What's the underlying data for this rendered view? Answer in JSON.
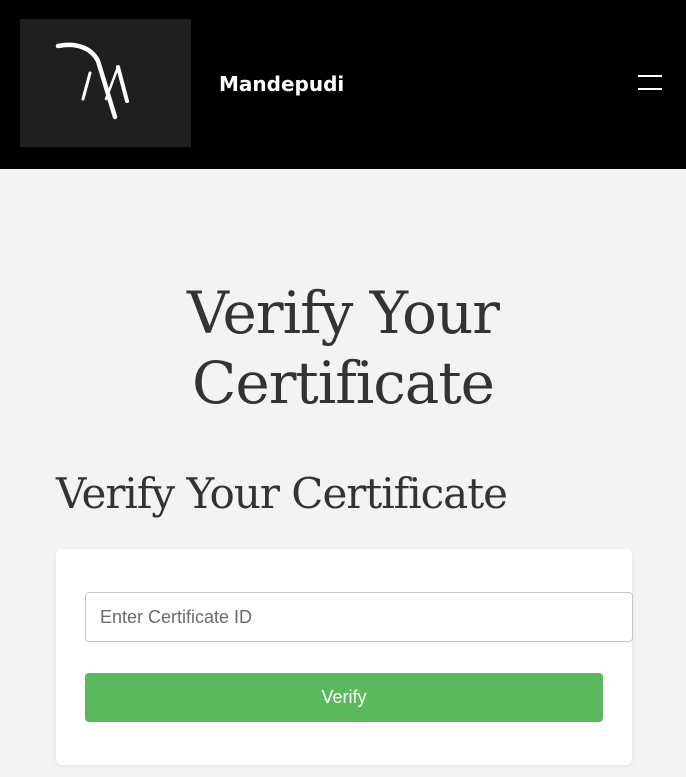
{
  "header": {
    "site_name": "Mandepudi",
    "logo_icon": "m-monogram-logo",
    "menu_icon": "hamburger-menu-icon"
  },
  "hero": {
    "title_line1": "Verify Your",
    "title_line2": "Certificate"
  },
  "section": {
    "title": "Verify Your Certificate"
  },
  "form": {
    "certificate_id": {
      "value": "",
      "placeholder": "Enter Certificate ID"
    },
    "verify_label": "Verify"
  },
  "colors": {
    "header_bg": "#000000",
    "logo_bg": "#1f1f1f",
    "page_bg": "#f3f3f3",
    "button_green": "#5cb85c"
  }
}
